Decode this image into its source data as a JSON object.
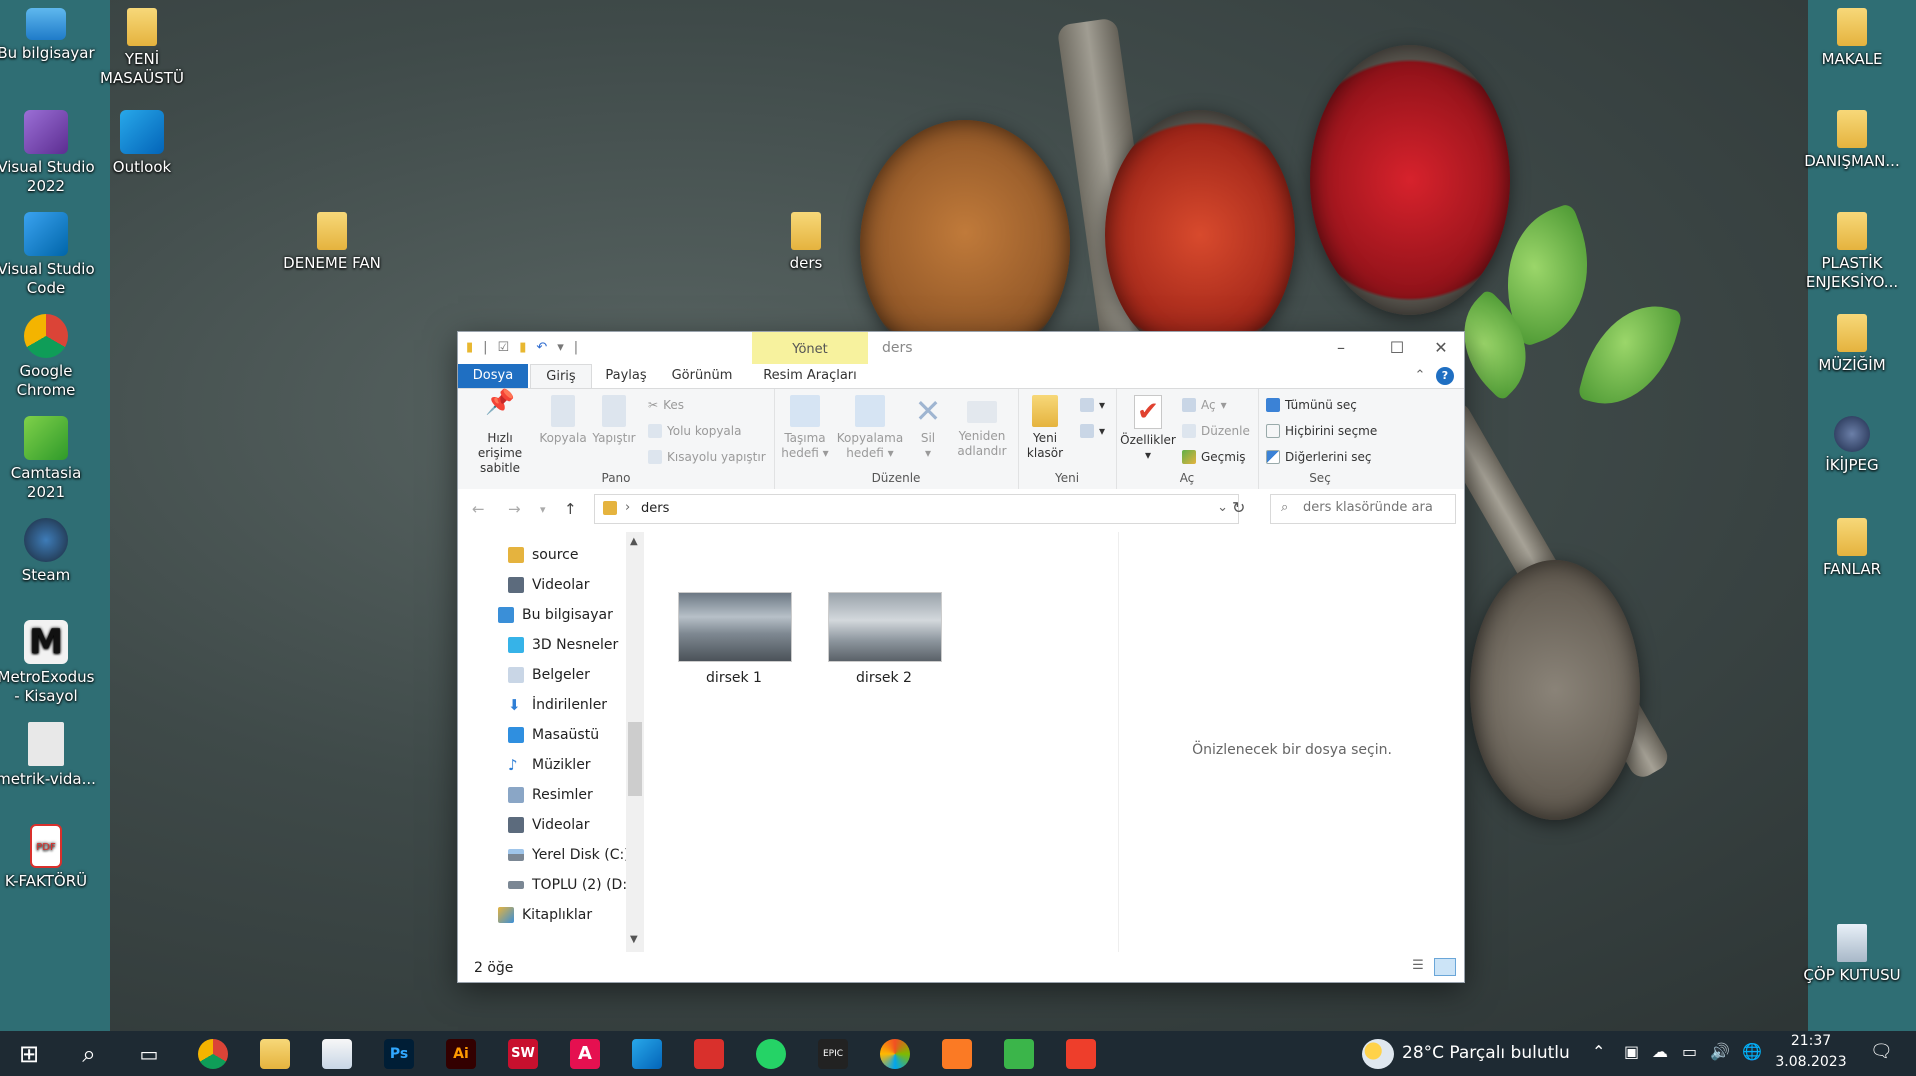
{
  "desktop": {
    "left_icons": [
      {
        "label": "Bu bilgisayar",
        "icon": "this-pc-icon"
      },
      {
        "label": "Visual Studio 2022",
        "icon": "visual-studio-icon"
      },
      {
        "label": "Visual Studio Code",
        "icon": "vscode-icon"
      },
      {
        "label": "Google Chrome",
        "icon": "chrome-icon"
      },
      {
        "label": "Camtasia 2021",
        "icon": "camtasia-icon"
      },
      {
        "label": "Steam",
        "icon": "steam-icon"
      },
      {
        "label": "MetroExodus - Kisayol",
        "icon": "metro-exodus-icon"
      },
      {
        "label": "metrik-vida...",
        "icon": "document-icon"
      },
      {
        "label": "K-FAKTÖRÜ",
        "icon": "pdf-icon"
      }
    ],
    "second_col_icons": [
      {
        "label": "YENİ MASAÜSTÜ",
        "icon": "zip-folder-icon"
      },
      {
        "label": "Outlook",
        "icon": "outlook-icon"
      }
    ],
    "free_icons": [
      {
        "label": "DENEME FAN",
        "icon": "folder-icon"
      },
      {
        "label": "ders",
        "icon": "folder-icon"
      }
    ],
    "right_icons": [
      {
        "label": "MAKALE",
        "icon": "zip-folder-icon"
      },
      {
        "label": "DANIŞMAN...",
        "icon": "zip-folder-icon"
      },
      {
        "label": "PLASTİK ENJEKSİYO...",
        "icon": "zip-folder-icon"
      },
      {
        "label": "MÜZİĞİM",
        "icon": "folder-icon"
      },
      {
        "label": "İKİJPEG",
        "icon": "image-icon"
      },
      {
        "label": "FANLAR",
        "icon": "zip-folder-icon"
      },
      {
        "label": "ÇÖP KUTUSU",
        "icon": "recycle-bin-icon"
      }
    ]
  },
  "explorer": {
    "title": "ders",
    "context_tab": "Yönet",
    "tabs": [
      "Dosya",
      "Giriş",
      "Paylaş",
      "Görünüm",
      "Resim Araçları"
    ],
    "ribbon": {
      "pano": {
        "label": "Pano",
        "pin": "Hızlı erişime sabitle",
        "copy": "Kopyala",
        "paste": "Yapıştır",
        "cut": "Kes",
        "copy_path": "Yolu kopyala",
        "paste_shortcut": "Kısayolu yapıştır"
      },
      "duzenle": {
        "label": "Düzenle",
        "move_to": "Taşıma hedefi",
        "copy_to": "Kopyalama hedefi",
        "delete": "Sil",
        "rename": "Yeniden adlandır"
      },
      "yeni": {
        "label": "Yeni",
        "new_folder": "Yeni klasör"
      },
      "ac": {
        "label": "Aç",
        "properties": "Özellikler",
        "open": "Aç",
        "edit": "Düzenle",
        "history": "Geçmiş"
      },
      "sec": {
        "label": "Seç",
        "select_all": "Tümünü seç",
        "select_none": "Hiçbirini seçme",
        "invert": "Diğerlerini seç"
      }
    },
    "address": {
      "path": "ders"
    },
    "search": {
      "placeholder": "ders klasöründe ara"
    },
    "tree": [
      {
        "label": "source",
        "icon": "folder-icon",
        "indent": 2
      },
      {
        "label": "Videolar",
        "icon": "videos-icon",
        "indent": 2
      },
      {
        "label": "Bu bilgisayar",
        "icon": "this-pc-icon",
        "indent": 1
      },
      {
        "label": "3D Nesneler",
        "icon": "3d-objects-icon",
        "indent": 2
      },
      {
        "label": "Belgeler",
        "icon": "documents-icon",
        "indent": 2
      },
      {
        "label": "İndirilenler",
        "icon": "downloads-icon",
        "indent": 2
      },
      {
        "label": "Masaüstü",
        "icon": "desktop-icon",
        "indent": 2
      },
      {
        "label": "Müzikler",
        "icon": "music-icon",
        "indent": 2
      },
      {
        "label": "Resimler",
        "icon": "pictures-icon",
        "indent": 2
      },
      {
        "label": "Videolar",
        "icon": "videos-icon",
        "indent": 2
      },
      {
        "label": "Yerel Disk (C:)",
        "icon": "drive-icon",
        "indent": 2
      },
      {
        "label": "TOPLU (2) (D:)",
        "icon": "drive-icon",
        "indent": 2
      },
      {
        "label": "Kitaplıklar",
        "icon": "libraries-icon",
        "indent": 1
      }
    ],
    "files": [
      {
        "name": "dirsek 1"
      },
      {
        "name": "dirsek 2"
      }
    ],
    "preview_text": "Önizlenecek bir dosya seçin.",
    "status": "2 öğe"
  },
  "taskbar": {
    "weather": "28°C  Parçalı bulutlu",
    "time": "21:37",
    "date": "3.08.2023",
    "apps": [
      "start-icon",
      "search-icon",
      "task-view-icon",
      "chrome-icon",
      "file-explorer-icon",
      "store-icon",
      "photoshop-icon",
      "illustrator-icon",
      "solidworks-icon",
      "autocad-icon",
      "outlook-icon",
      "solidworks-tools-icon",
      "whatsapp-icon",
      "epic-games-icon",
      "paint-icon",
      "xampp-icon",
      "camtasia-icon",
      "camtasia-recorder-icon"
    ]
  },
  "colors": {
    "file_tab": "#1f6fc2",
    "context_tab": "#f7f29e",
    "taskbar": "#1e2a33",
    "desktop_strip": "#2f6e74"
  }
}
